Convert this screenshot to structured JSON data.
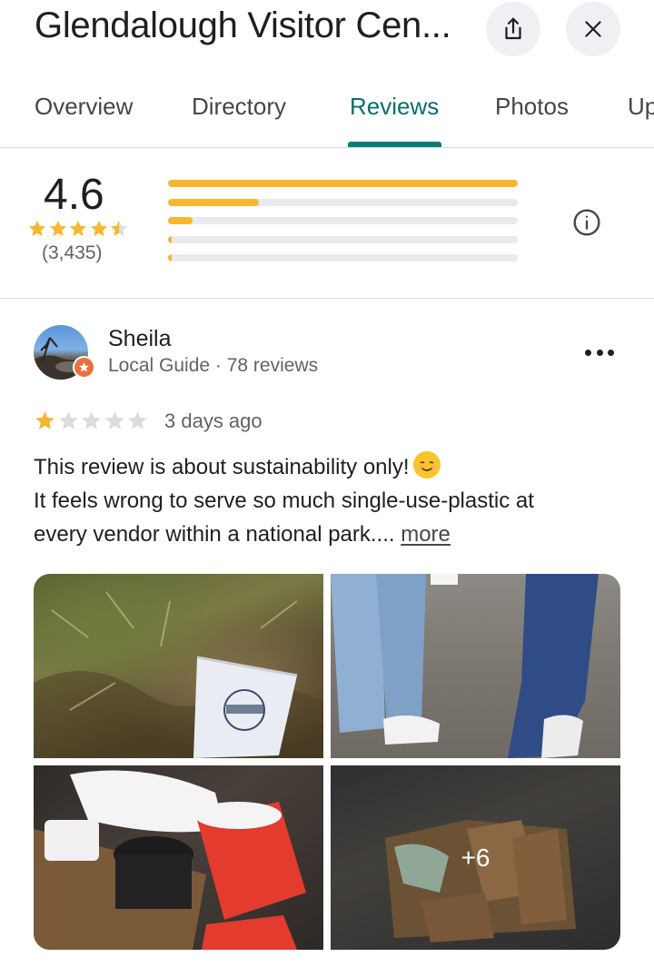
{
  "header": {
    "title": "Glendalough Visitor Cen...",
    "share_icon": "share-icon",
    "close_icon": "close-icon"
  },
  "tabs": [
    {
      "label": "Overview",
      "active": false
    },
    {
      "label": "Directory",
      "active": false
    },
    {
      "label": "Reviews",
      "active": true
    },
    {
      "label": "Photos",
      "active": false
    },
    {
      "label": "Up",
      "active": false
    }
  ],
  "summary": {
    "rating": "4.6",
    "stars_filled": 4.5,
    "count": "(3,435)",
    "distribution_fraction": [
      1.0,
      0.26,
      0.07,
      0.01,
      0.01
    ],
    "bar_color": "#f6b72e",
    "info_icon": "info-icon"
  },
  "review": {
    "reviewer_name": "Sheila",
    "reviewer_meta": "Local Guide · 78 reviews",
    "badge_icon": "local-guide-star-icon",
    "more_options_icon": "more-options-icon",
    "stars_filled": 1,
    "date": "3 days ago",
    "text_line1": "This review is about sustainability only!",
    "emoji_icon": "smiling-face-emoji",
    "text_line2": "It feels wrong to serve so much single-use-plastic at",
    "text_line3": "every vendor within a national park....",
    "more_label": "more",
    "photos": [
      {
        "name": "cup-litter-photo"
      },
      {
        "name": "walkers-photo"
      },
      {
        "name": "bin-cups-photo"
      },
      {
        "name": "bin-trash-photo",
        "overlay": "+6"
      }
    ]
  },
  "colors": {
    "accent": "#0b6f6a",
    "star": "#f6b72e",
    "star_empty": "#dadce0",
    "badge": "#e8703a"
  }
}
